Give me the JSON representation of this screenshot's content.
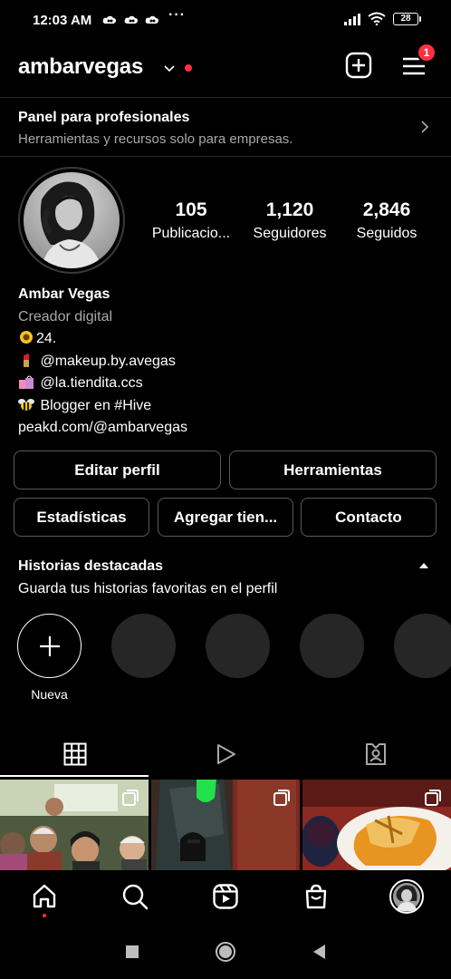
{
  "status_bar": {
    "time": "12:03 AM",
    "dots": "···",
    "battery": "28",
    "icons": [
      "cloud-icon",
      "cloud-icon",
      "cloud-icon",
      "signal-icon",
      "wifi-icon",
      "battery-icon"
    ]
  },
  "header": {
    "username": "ambarvegas",
    "notification_count": "1",
    "icons": [
      "chevron-down-icon",
      "new-post-icon",
      "hamburger-menu-icon"
    ]
  },
  "pro_panel": {
    "title": "Panel para profesionales",
    "subtitle": "Herramientas y recursos solo para empresas."
  },
  "stats": [
    {
      "value": "105",
      "label": "Publicacio..."
    },
    {
      "value": "1,120",
      "label": "Seguidores"
    },
    {
      "value": "2,846",
      "label": "Seguidos"
    }
  ],
  "bio": {
    "name": "Ambar Vegas",
    "category": "Creador digital",
    "line1": "24.",
    "line2": "@makeup.by.avegas",
    "line3": "@la.tiendita.ccs",
    "line4": "Blogger en #Hive",
    "link": "peakd.com/@ambarvegas",
    "emojis": [
      "sunflower-icon",
      "lipstick-icon",
      "shopping-bags-icon",
      "bee-icon"
    ]
  },
  "buttons": {
    "edit_profile": "Editar perfil",
    "tools": "Herramientas",
    "insights": "Estadísticas",
    "add_shop": "Agregar tien...",
    "contact": "Contacto"
  },
  "highlights": {
    "title": "Historias destacadas",
    "subtitle": "Guarda tus historias favoritas en el perfil",
    "new_label": "Nueva"
  },
  "tabs": [
    "grid-icon",
    "reels-icon",
    "tagged-icon"
  ],
  "bottom_nav": [
    "home-icon",
    "search-icon",
    "reels-icon",
    "shop-icon",
    "profile-avatar"
  ],
  "colors": {
    "background": "#000000",
    "accent_red": "#ff3040",
    "secondary_text": "#a8a8a8",
    "highlight_placeholder": "#262626"
  }
}
